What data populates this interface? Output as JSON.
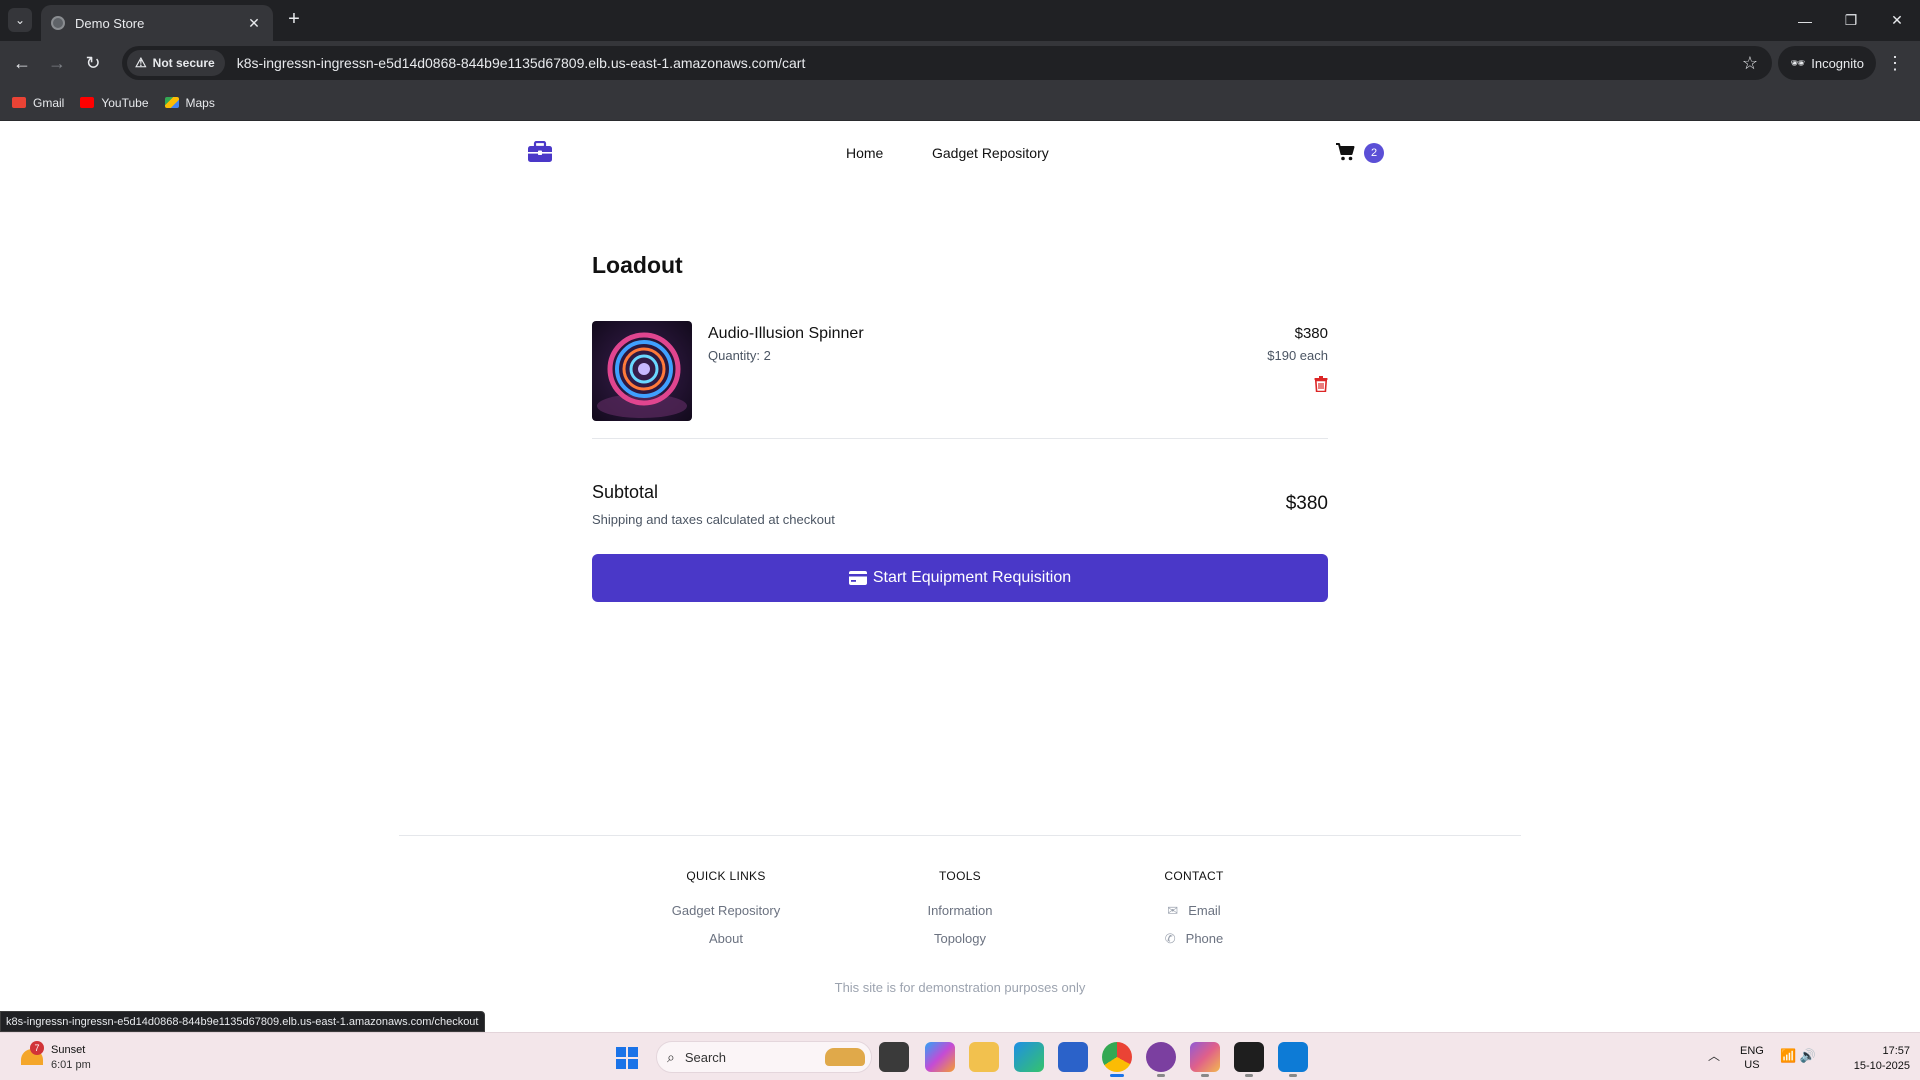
{
  "browser": {
    "tab_title": "Demo Store",
    "security_label": "Not secure",
    "url": "k8s-ingressn-ingressn-e5d14d0868-844b9e1135d67809.elb.us-east-1.amazonaws.com/cart",
    "profile_label": "Incognito",
    "bookmarks": [
      {
        "label": "Gmail",
        "icon": "gmail-icon",
        "color": "#ea4335"
      },
      {
        "label": "YouTube",
        "icon": "youtube-icon",
        "color": "#ff0000"
      },
      {
        "label": "Maps",
        "icon": "maps-icon",
        "color": "#34a853"
      }
    ],
    "status_url": "k8s-ingressn-ingressn-e5d14d0868-844b9e1135d67809.elb.us-east-1.amazonaws.com/checkout"
  },
  "site": {
    "accent_color": "#4a38c8",
    "nav": {
      "home": "Home",
      "repository": "Gadget Repository"
    },
    "cart_count": "2"
  },
  "cart": {
    "title": "Loadout",
    "items": [
      {
        "name": "Audio-Illusion Spinner",
        "quantity_text": "Quantity: 2",
        "total": "$380",
        "unit_price": "$190 each",
        "image_icon": "spinner-product-image"
      }
    ],
    "subtotal_label": "Subtotal",
    "subtotal_note": "Shipping and taxes calculated at checkout",
    "subtotal_value": "$380",
    "checkout_label": "Start Equipment Requisition"
  },
  "footer": {
    "quick_links": {
      "heading": "QUICK LINKS",
      "links": [
        "Gadget Repository",
        "About"
      ]
    },
    "tools": {
      "heading": "TOOLS",
      "links": [
        "Information",
        "Topology"
      ]
    },
    "contact": {
      "heading": "CONTACT",
      "links": [
        "Email",
        "Phone"
      ]
    },
    "note": "This site is for demonstration purposes only"
  },
  "taskbar": {
    "weather_badge": "7",
    "weather_title": "Sunset",
    "weather_time": "6:01 pm",
    "search_placeholder": "Search",
    "lang_1": "ENG",
    "lang_2": "US",
    "time": "17:57",
    "date": "15-10-2025"
  }
}
